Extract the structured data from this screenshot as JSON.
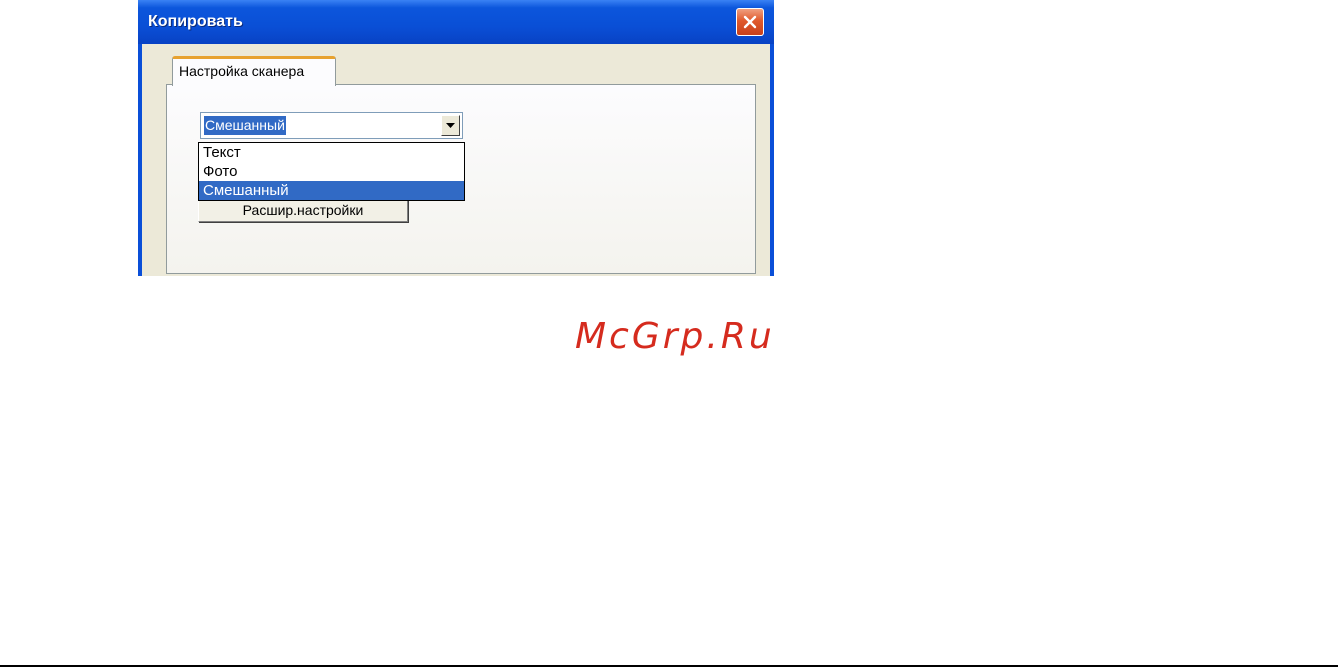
{
  "window": {
    "title": "Копировать",
    "close_icon": "close-icon"
  },
  "tab": {
    "label": "Настройка сканера"
  },
  "combo": {
    "selected_value": "Смешанный",
    "arrow_icon": "chevron-down-icon",
    "options": [
      "Текст",
      "Фото",
      "Смешанный"
    ],
    "highlighted_index": 2
  },
  "advanced_button": {
    "label": "Расшир.настройки"
  },
  "watermark": {
    "text": "McGrp.Ru"
  },
  "colors": {
    "titlebar": "#0a4fd6",
    "selection": "#316ac5",
    "dialog_face": "#ece9d8",
    "watermark": "#d52b1e"
  }
}
